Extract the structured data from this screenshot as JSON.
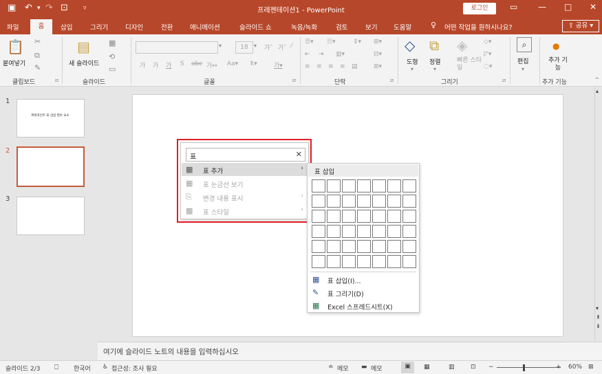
{
  "titlebar": {
    "title": "프레젠테이션1 - PowerPoint",
    "login_label": "로그인",
    "save_icon": "save-icon",
    "undo_icon": "undo-icon",
    "redo_icon": "redo-icon",
    "start_icon": "start-from-beginning-icon"
  },
  "tabs": {
    "items": [
      "파일",
      "홈",
      "삽입",
      "그리기",
      "디자인",
      "전환",
      "애니메이션",
      "슬라이드 쇼",
      "녹음/녹화",
      "검토",
      "보기",
      "도움말"
    ],
    "tell_me": "어떤 작업을 원하시나요?",
    "share": "공유"
  },
  "ribbon": {
    "clipboard": {
      "paste": "붙여넣기",
      "group": "클립보드"
    },
    "slides": {
      "new_slide": "새 슬라이드",
      "group": "슬라이드"
    },
    "font": {
      "size": "18",
      "group": "글꼴"
    },
    "paragraph": {
      "group": "단락"
    },
    "drawing": {
      "shapes": "도형",
      "arrange": "정렬",
      "quick_styles": "빠른 스타일",
      "group": "그리기"
    },
    "editing": {
      "label": "편집"
    },
    "addins": {
      "label": "추가 기능",
      "group": "추가 기능"
    }
  },
  "thumbnails": [
    {
      "number": "1",
      "text": "파워포인트 표 삽입 필수 요소"
    },
    {
      "number": "2",
      "text": ""
    },
    {
      "number": "3",
      "text": ""
    }
  ],
  "context_menu": {
    "search_value": "표",
    "items": [
      {
        "label": "표 추가",
        "enabled": true,
        "icon": "table-icon",
        "has_submenu": true
      },
      {
        "label": "표 눈금선 보기",
        "enabled": false,
        "icon": "gridlines-icon",
        "has_submenu": false
      },
      {
        "label": "변경 내용 표시",
        "enabled": false,
        "icon": "show-changes-icon",
        "has_submenu": true
      },
      {
        "label": "표 스타일",
        "enabled": false,
        "icon": "table-style-icon",
        "has_submenu": true
      }
    ]
  },
  "submenu": {
    "header": "표 삽입",
    "grid_cols": 7,
    "grid_rows": 6,
    "items": [
      {
        "label": "표 삽입(I)...",
        "icon": "insert-table-icon"
      },
      {
        "label": "표 그리기(D)",
        "icon": "draw-table-icon"
      },
      {
        "label": "Excel 스프레드시트(X)",
        "icon": "excel-icon"
      }
    ]
  },
  "notes": {
    "placeholder": "여기에 슬라이드 노트의 내용을 입력하십시오"
  },
  "status": {
    "slide": "슬라이드 2/3",
    "language": "한국어",
    "accessibility": "접근성: 조사 필요",
    "notes": "메모",
    "comments": "메모",
    "zoom": "60%"
  },
  "colors": {
    "accent": "#b7472a",
    "highlight": "#e31b23"
  }
}
